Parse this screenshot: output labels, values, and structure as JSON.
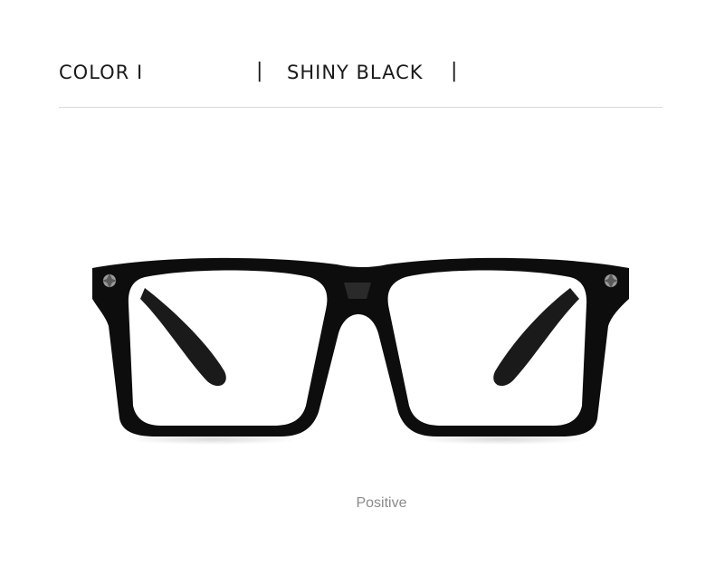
{
  "header": {
    "color_label": "COLOR I",
    "separator": "|",
    "color_value": "SHINY BLACK"
  },
  "product": {
    "image_icon": "eyeglasses-image",
    "frame_color": "#0d0d0d",
    "lens_color": "#ffffff",
    "rivet_icon": "fleur-de-lis-rivet-icon"
  },
  "caption": "Positive"
}
